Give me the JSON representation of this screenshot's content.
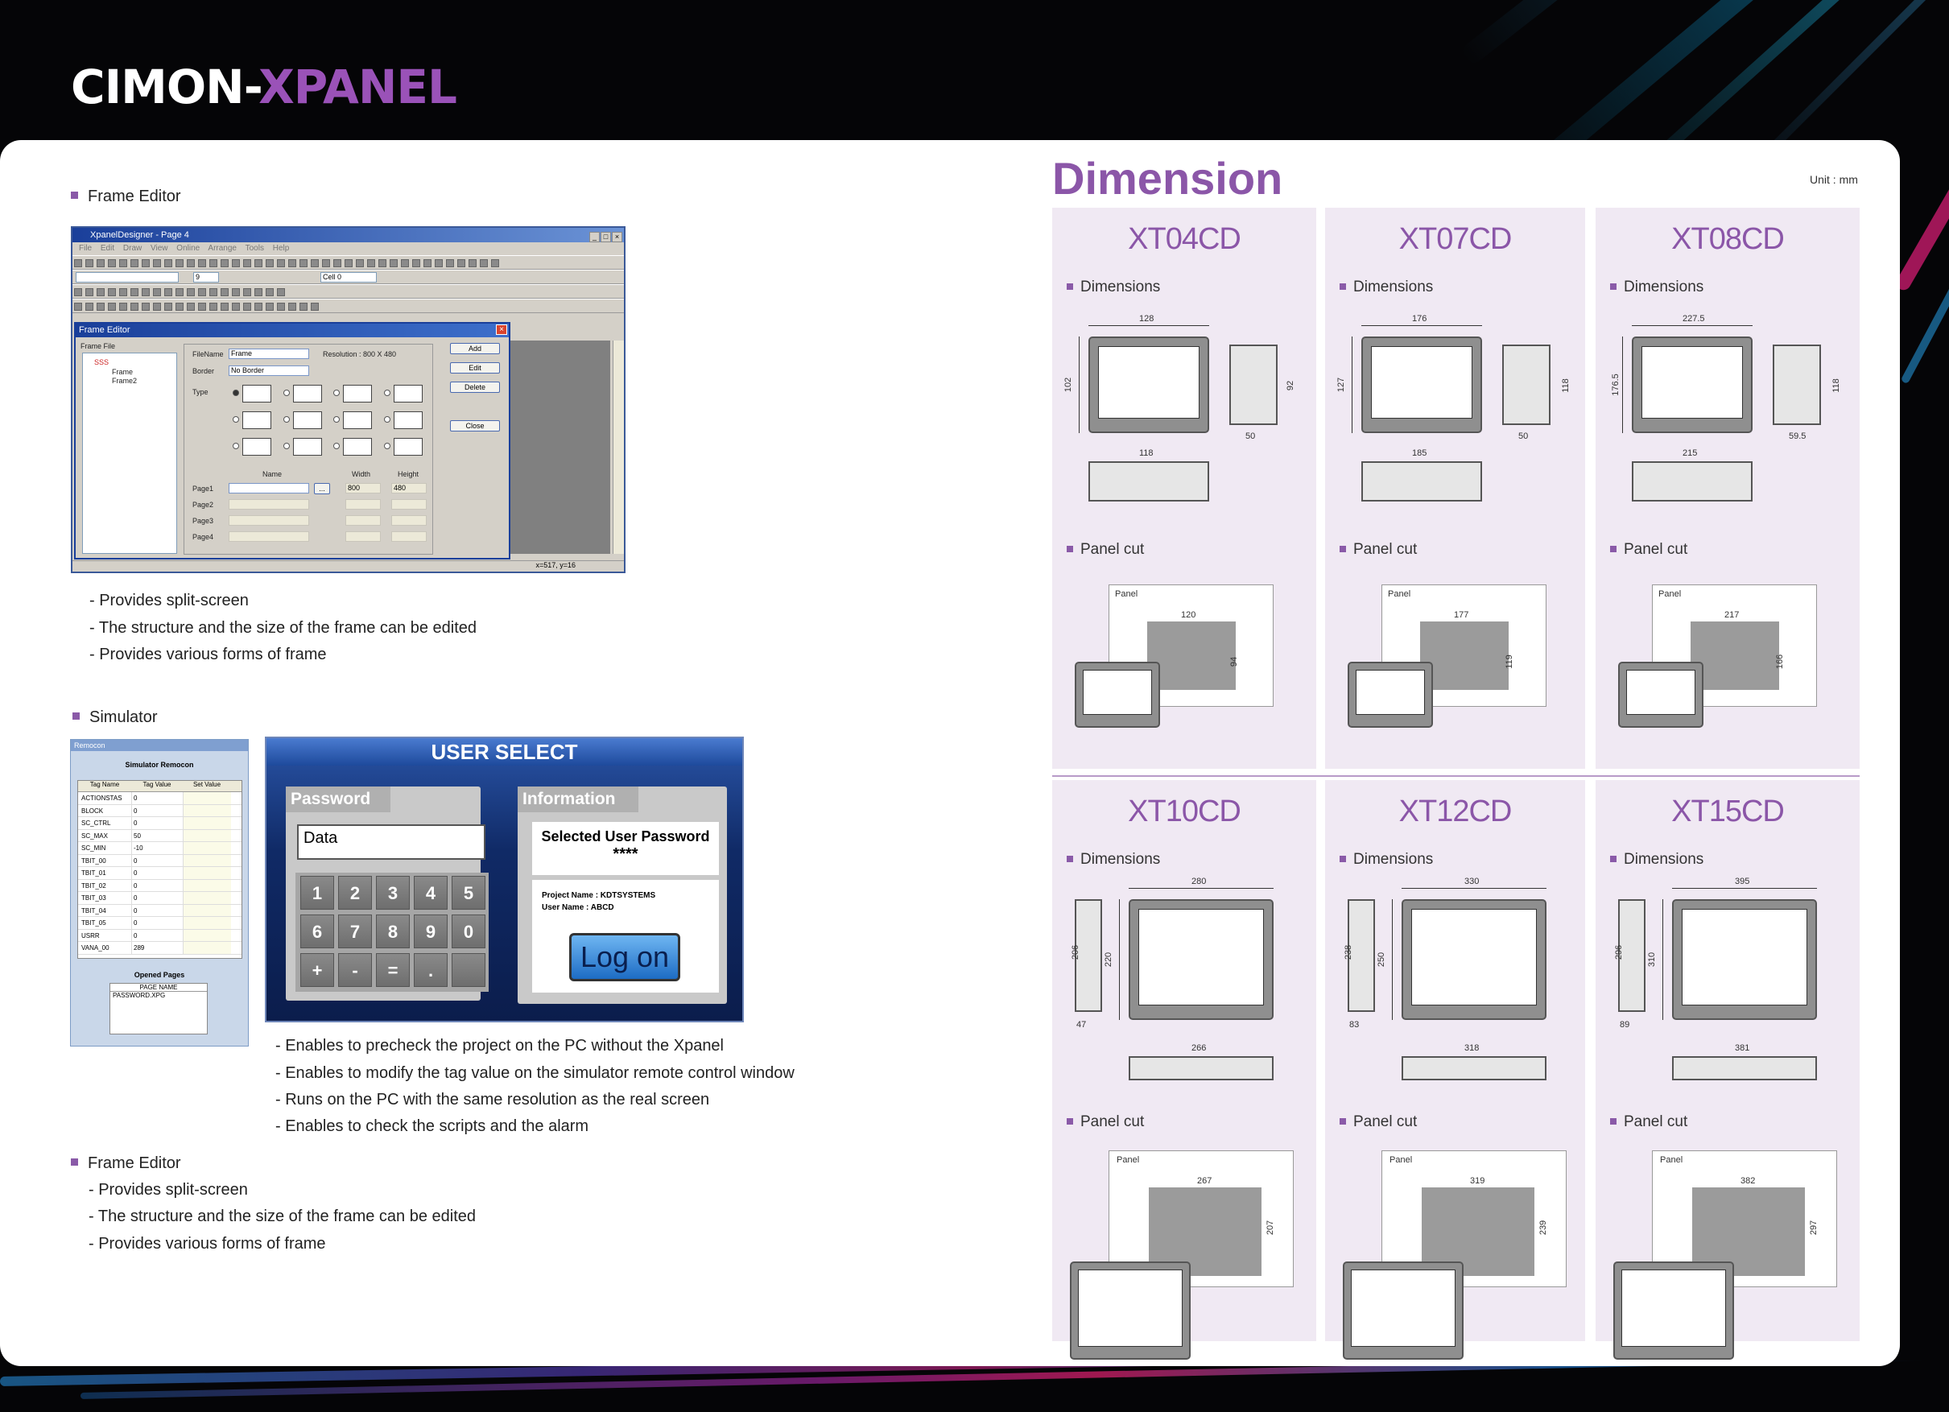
{
  "brand": {
    "part1": "CIMON-",
    "part2": "XPANEL"
  },
  "left": {
    "frame_editor_heading": "Frame Editor",
    "frame_editor_bullets": [
      "- Provides split-screen",
      "- The structure and the size of the frame can be edited",
      "- Provides various forms of frame"
    ],
    "simulator_heading": "Simulator",
    "simulator_bullets": [
      "- Enables to precheck the project on the PC without the Xpanel",
      "- Enables to modify the tag value on the simulator remote control window",
      "- Runs on the PC with the same resolution as the real screen",
      "- Enables to check the scripts and the alarm"
    ],
    "frame_editor2_heading": "Frame Editor",
    "frame_editor2_bullets": [
      "- Provides split-screen",
      "- The structure and the size of the frame can be edited",
      "- Provides various forms of frame"
    ]
  },
  "designer": {
    "title": "XpanelDesigner - Page 4",
    "menu": "File Edit Draw View Online Arrange Tools Help",
    "cell_label": "Cell 0",
    "font_size": "9",
    "status": "x=517, y=16",
    "dialog": {
      "title": "Frame Editor",
      "frame_file": "Frame File",
      "tree": [
        "SSS",
        "Frame",
        "Frame2"
      ],
      "file_name_label": "FileName",
      "file_name_value": "Frame",
      "resolution": "Resolution : 800 X 480",
      "border_label": "Border",
      "border_value": "No Border",
      "type_label": "Type",
      "col_name": "Name",
      "col_width": "Width",
      "col_height": "Height",
      "pages": [
        "Page1",
        "Page2",
        "Page3",
        "Page4"
      ],
      "page1_width": "800",
      "page1_height": "480",
      "browse": "...",
      "buttons": {
        "add": "Add",
        "edit": "Edit",
        "delete": "Delete",
        "close": "Close"
      }
    }
  },
  "sim_remote": {
    "title": "Remocon",
    "heading": "Simulator Remocon",
    "cols": [
      "Tag Name",
      "Tag Value",
      "Set Value"
    ],
    "rows": [
      [
        "ACTIONSTAS",
        "0"
      ],
      [
        "BLOCK",
        "0"
      ],
      [
        "SC_CTRL",
        "0"
      ],
      [
        "SC_MAX",
        "50"
      ],
      [
        "SC_MIN",
        "-10"
      ],
      [
        "TBIT_00",
        "0"
      ],
      [
        "TBIT_01",
        "0"
      ],
      [
        "TBIT_02",
        "0"
      ],
      [
        "TBIT_03",
        "0"
      ],
      [
        "TBIT_04",
        "0"
      ],
      [
        "TBIT_05",
        "0"
      ],
      [
        "USRR",
        "0"
      ],
      [
        "VANA_00",
        "289"
      ]
    ],
    "opened_pages": "Opened Pages",
    "page_name": "PAGE NAME",
    "page_file": "PASSWORD.XPG"
  },
  "user_select": {
    "title": "USER SELECT",
    "password_tab": "Password",
    "info_tab": "Information",
    "data_field": "Data",
    "keys": [
      "1",
      "2",
      "3",
      "4",
      "5",
      "6",
      "7",
      "8",
      "9",
      "0",
      "+",
      "-",
      "=",
      ".",
      ""
    ],
    "selected_label": "Selected User Password",
    "stars": "****",
    "project_name": "Project Name : KDTSYSTEMS",
    "user_name": "User Name : ABCD",
    "logon": "Log on"
  },
  "dimension": {
    "title": "Dimension",
    "unit": "Unit : mm",
    "dims_label": "Dimensions",
    "cut_label": "Panel cut",
    "panel_word": "Panel",
    "models": [
      {
        "name": "XT04CD",
        "w": "128",
        "h": "102",
        "depth": "50",
        "side_h": "92",
        "bottom": "118",
        "cut_w": "120",
        "cut_h": "94"
      },
      {
        "name": "XT07CD",
        "w": "176",
        "h": "127",
        "depth": "50",
        "side_h": "118",
        "bottom": "185",
        "cut_w": "177",
        "cut_h": "119"
      },
      {
        "name": "XT08CD",
        "w": "227.5",
        "h": "176.5",
        "depth": "59.5",
        "side_h": "118",
        "bottom": "215",
        "cut_w": "217",
        "cut_h": "166"
      },
      {
        "name": "XT10CD",
        "w": "280",
        "h": "220",
        "depth": "47",
        "side_h": "206",
        "bottom": "266",
        "cut_w": "267",
        "cut_h": "207"
      },
      {
        "name": "XT12CD",
        "w": "330",
        "h": "250",
        "depth": "83",
        "side_h": "238",
        "bottom": "318",
        "cut_w": "319",
        "cut_h": "239"
      },
      {
        "name": "XT15CD",
        "w": "395",
        "h": "310",
        "depth": "89",
        "side_h": "296",
        "bottom": "381",
        "cut_w": "382",
        "cut_h": "297"
      }
    ]
  }
}
